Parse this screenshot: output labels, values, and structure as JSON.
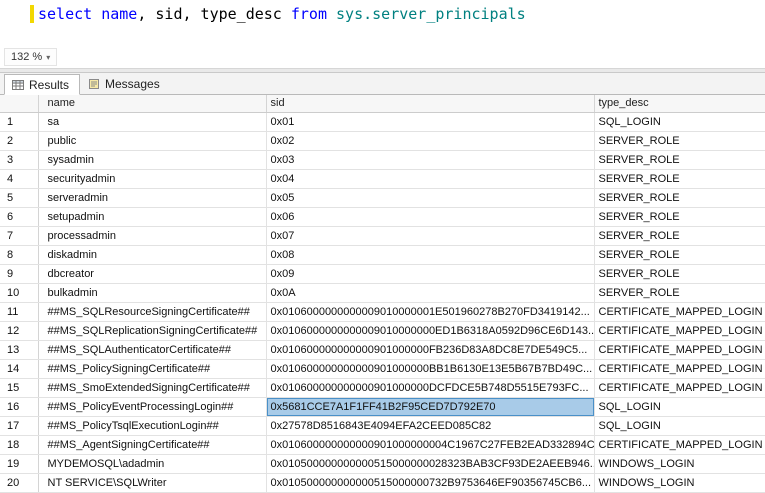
{
  "colors": {
    "keyword": "#0000ff",
    "plain": "#000000",
    "system": "#008080",
    "selection_bg": "#a8cbe8",
    "selection_border": "#4a90c8"
  },
  "editor": {
    "tokens": [
      {
        "text": "select",
        "type": "keyword"
      },
      {
        "text": " ",
        "type": "plain"
      },
      {
        "text": "name",
        "type": "keyword"
      },
      {
        "text": ", sid, type_desc ",
        "type": "plain"
      },
      {
        "text": "from",
        "type": "keyword"
      },
      {
        "text": " ",
        "type": "plain"
      },
      {
        "text": "sys.server_principals",
        "type": "system"
      }
    ]
  },
  "statusbar": {
    "zoom_label": "132 %"
  },
  "tabs": [
    {
      "label": "Results",
      "icon": "results-grid-icon",
      "active": true
    },
    {
      "label": "Messages",
      "icon": "messages-icon",
      "active": false
    }
  ],
  "grid": {
    "columns": [
      "name",
      "sid",
      "type_desc"
    ],
    "selected_cell": {
      "row": 16,
      "column": "sid"
    },
    "rows": [
      {
        "num": "1",
        "name": "sa",
        "sid": "0x01",
        "type_desc": "SQL_LOGIN"
      },
      {
        "num": "2",
        "name": "public",
        "sid": "0x02",
        "type_desc": "SERVER_ROLE"
      },
      {
        "num": "3",
        "name": "sysadmin",
        "sid": "0x03",
        "type_desc": "SERVER_ROLE"
      },
      {
        "num": "4",
        "name": "securityadmin",
        "sid": "0x04",
        "type_desc": "SERVER_ROLE"
      },
      {
        "num": "5",
        "name": "serveradmin",
        "sid": "0x05",
        "type_desc": "SERVER_ROLE"
      },
      {
        "num": "6",
        "name": "setupadmin",
        "sid": "0x06",
        "type_desc": "SERVER_ROLE"
      },
      {
        "num": "7",
        "name": "processadmin",
        "sid": "0x07",
        "type_desc": "SERVER_ROLE"
      },
      {
        "num": "8",
        "name": "diskadmin",
        "sid": "0x08",
        "type_desc": "SERVER_ROLE"
      },
      {
        "num": "9",
        "name": "dbcreator",
        "sid": "0x09",
        "type_desc": "SERVER_ROLE"
      },
      {
        "num": "10",
        "name": "bulkadmin",
        "sid": "0x0A",
        "type_desc": "SERVER_ROLE"
      },
      {
        "num": "11",
        "name": "##MS_SQLResourceSigningCertificate##",
        "sid": "0x0106000000000009010000001E501960278B270FD3419142...",
        "type_desc": "CERTIFICATE_MAPPED_LOGIN"
      },
      {
        "num": "12",
        "name": "##MS_SQLReplicationSigningCertificate##",
        "sid": "0x0106000000000009010000000ED1B6318A0592D96CE6D143...",
        "type_desc": "CERTIFICATE_MAPPED_LOGIN"
      },
      {
        "num": "13",
        "name": "##MS_SQLAuthenticatorCertificate##",
        "sid": "0x010600000000000901000000FB236D83A8DC8E7DE549C5...",
        "type_desc": "CERTIFICATE_MAPPED_LOGIN"
      },
      {
        "num": "14",
        "name": "##MS_PolicySigningCertificate##",
        "sid": "0x010600000000000901000000BB1B6130E13E5B67B7BD49C...",
        "type_desc": "CERTIFICATE_MAPPED_LOGIN"
      },
      {
        "num": "15",
        "name": "##MS_SmoExtendedSigningCertificate##",
        "sid": "0x010600000000000901000000DCFDCE5B748D5515E793FC...",
        "type_desc": "CERTIFICATE_MAPPED_LOGIN"
      },
      {
        "num": "16",
        "name": "##MS_PolicyEventProcessingLogin##",
        "sid": "0x5681CCE7A1F1FF41B2F95CED7D792E70",
        "type_desc": "SQL_LOGIN"
      },
      {
        "num": "17",
        "name": "##MS_PolicyTsqlExecutionLogin##",
        "sid": "0x27578D8516843E4094EFA2CEED085C82",
        "type_desc": "SQL_LOGIN"
      },
      {
        "num": "18",
        "name": "##MS_AgentSigningCertificate##",
        "sid": "0x010600000000000901000000004C1967C27FEB2EAD332894C...",
        "type_desc": "CERTIFICATE_MAPPED_LOGIN"
      },
      {
        "num": "19",
        "name": "MYDEMOSQL\\adadmin",
        "sid": "0x010500000000000515000000028323BAB3CF93DE2AEEB946...",
        "type_desc": "WINDOWS_LOGIN"
      },
      {
        "num": "20",
        "name": "NT SERVICE\\SQLWriter",
        "sid": "0x010500000000000515000000732B9753646EF90356745CB6...",
        "type_desc": "WINDOWS_LOGIN"
      }
    ]
  }
}
